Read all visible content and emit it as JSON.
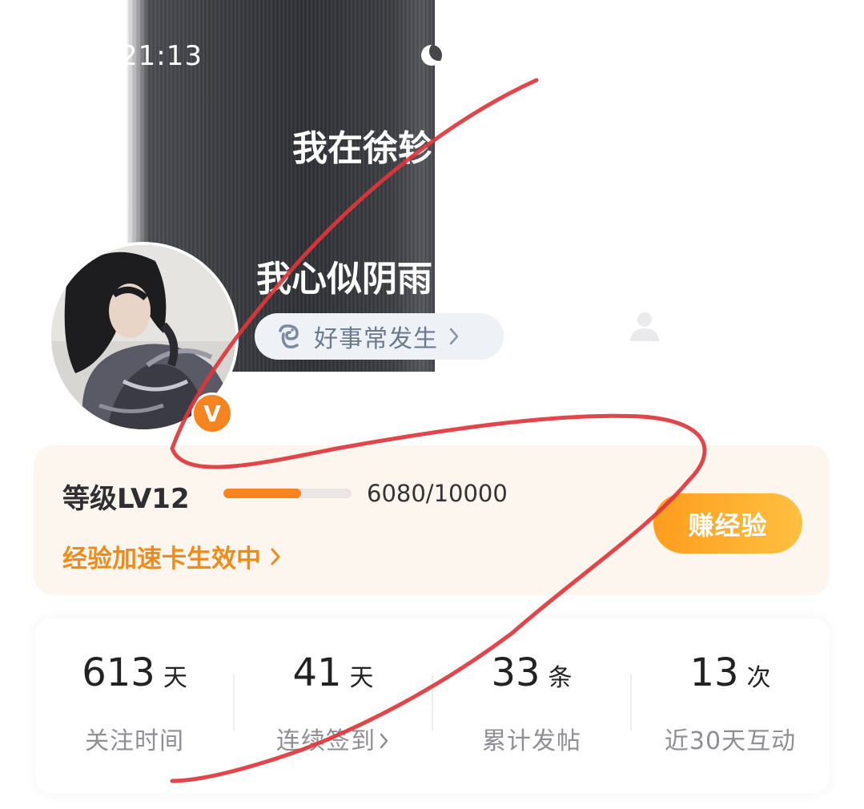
{
  "status_bar": {
    "time": "21:13"
  },
  "cover": {
    "line1": "我在徐轸",
    "line2": "我心似阴雨"
  },
  "profile": {
    "tag_label": "好事常发生",
    "verified_badge": "V"
  },
  "level": {
    "label": "等级LV12",
    "progress_current": 6080,
    "progress_max": 10000,
    "progress_text": "6080/10000",
    "boost_text": "经验加速卡生效中",
    "earn_button": "赚经验"
  },
  "stats": [
    {
      "value": "613",
      "unit": "天",
      "label": "关注时间"
    },
    {
      "value": "41",
      "unit": "天",
      "label": "连续签到"
    },
    {
      "value": "33",
      "unit": "条",
      "label": "累计发帖"
    },
    {
      "value": "13",
      "unit": "次",
      "label": "近30天互动"
    }
  ],
  "colors": {
    "accent": "#f7841e",
    "card_bg": "#fdf6ef",
    "annotation": "#e0353b"
  }
}
